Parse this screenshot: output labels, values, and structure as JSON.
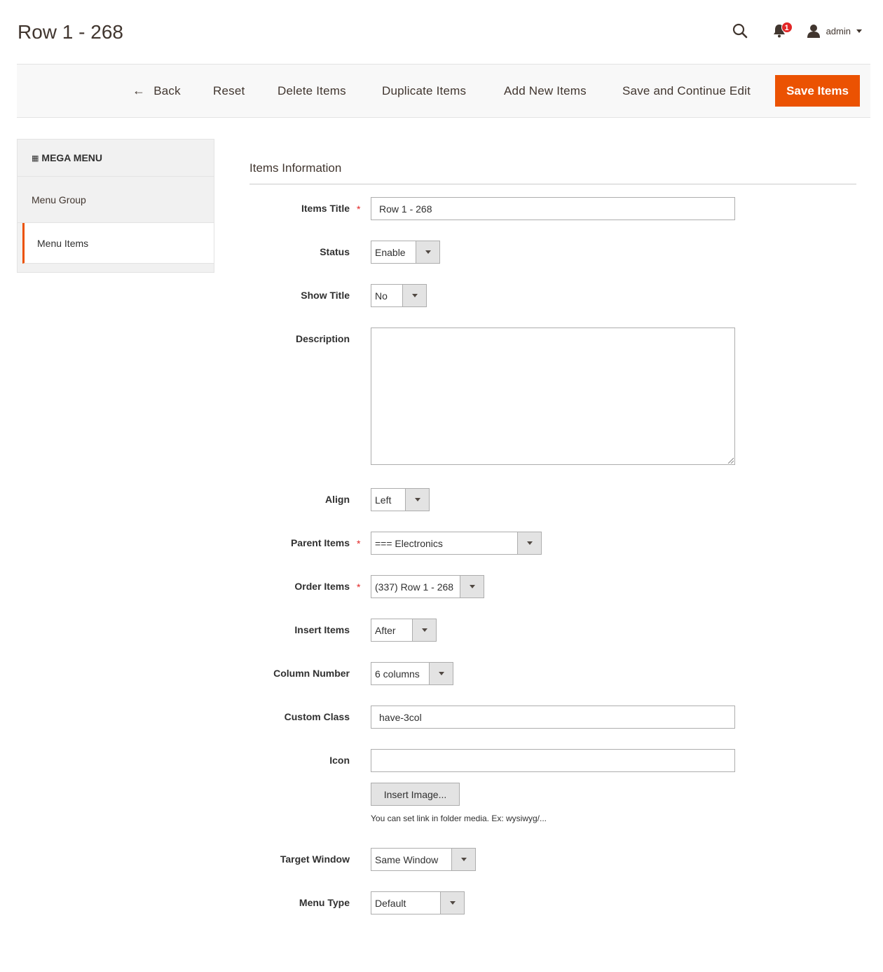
{
  "header": {
    "title": "Row 1 - 268",
    "notifications_count": "1",
    "user_name": "admin"
  },
  "toolbar": {
    "back": "Back",
    "reset": "Reset",
    "delete": "Delete Items",
    "duplicate": "Duplicate Items",
    "add_new": "Add New Items",
    "save_continue": "Save and Continue Edit",
    "save": "Save Items"
  },
  "sidebar": {
    "title": "MEGA MENU",
    "items": [
      {
        "label": "Menu Group",
        "active": false
      },
      {
        "label": "Menu Items",
        "active": true
      }
    ]
  },
  "form": {
    "section_title": "Items Information",
    "items_title": {
      "label": "Items Title",
      "value": "Row 1 - 268",
      "required": true
    },
    "status": {
      "label": "Status",
      "value": "Enable"
    },
    "show_title": {
      "label": "Show Title",
      "value": "No"
    },
    "description": {
      "label": "Description",
      "value": ""
    },
    "align": {
      "label": "Align",
      "value": "Left"
    },
    "parent_items": {
      "label": "Parent Items",
      "value": "=== Electronics",
      "required": true
    },
    "order_items": {
      "label": "Order Items",
      "value": "(337) Row 1 - 268",
      "required": true
    },
    "insert_items": {
      "label": "Insert Items",
      "value": "After"
    },
    "column_number": {
      "label": "Column Number",
      "value": "6 columns"
    },
    "custom_class": {
      "label": "Custom Class",
      "value": "have-3col"
    },
    "icon": {
      "label": "Icon",
      "value": "",
      "button": "Insert Image...",
      "note": "You can set link in folder media. Ex: wysiwyg/..."
    },
    "target_window": {
      "label": "Target Window",
      "value": "Same Window"
    },
    "menu_type": {
      "label": "Menu Type",
      "value": "Default"
    }
  },
  "colors": {
    "accent": "#eb5202",
    "badge": "#e22626",
    "required": "#e22626"
  },
  "icons": [
    "search-icon",
    "bell-icon",
    "user-icon",
    "arrow-left-icon",
    "chevron-down-icon",
    "mega-menu-icon"
  ]
}
